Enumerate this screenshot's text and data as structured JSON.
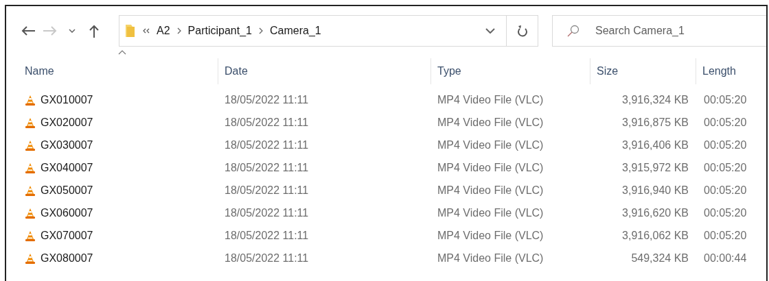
{
  "navigation": {
    "back_enabled": true,
    "forward_enabled": false
  },
  "address": {
    "segments": [
      {
        "label": "A2"
      },
      {
        "label": "Participant_1"
      },
      {
        "label": "Camera_1"
      }
    ]
  },
  "search": {
    "placeholder": "Search Camera_1"
  },
  "columns": [
    {
      "label": "Name",
      "sorted": true
    },
    {
      "label": "Date",
      "sorted": false
    },
    {
      "label": "Type",
      "sorted": false
    },
    {
      "label": "Size",
      "sorted": false
    },
    {
      "label": "Length",
      "sorted": false
    }
  ],
  "files": [
    {
      "name": "GX010007",
      "date": "18/05/2022 11:11",
      "type": "MP4 Video File (VLC)",
      "size": "3,916,324 KB",
      "length": "00:05:20"
    },
    {
      "name": "GX020007",
      "date": "18/05/2022 11:11",
      "type": "MP4 Video File (VLC)",
      "size": "3,916,875 KB",
      "length": "00:05:20"
    },
    {
      "name": "GX030007",
      "date": "18/05/2022 11:11",
      "type": "MP4 Video File (VLC)",
      "size": "3,916,406 KB",
      "length": "00:05:20"
    },
    {
      "name": "GX040007",
      "date": "18/05/2022 11:11",
      "type": "MP4 Video File (VLC)",
      "size": "3,915,972 KB",
      "length": "00:05:20"
    },
    {
      "name": "GX050007",
      "date": "18/05/2022 11:11",
      "type": "MP4 Video File (VLC)",
      "size": "3,916,940 KB",
      "length": "00:05:20"
    },
    {
      "name": "GX060007",
      "date": "18/05/2022 11:11",
      "type": "MP4 Video File (VLC)",
      "size": "3,916,620 KB",
      "length": "00:05:20"
    },
    {
      "name": "GX070007",
      "date": "18/05/2022 11:11",
      "type": "MP4 Video File (VLC)",
      "size": "3,916,062 KB",
      "length": "00:05:20"
    },
    {
      "name": "GX080007",
      "date": "18/05/2022 11:11",
      "type": "MP4 Video File (VLC)",
      "size": "549,324 KB",
      "length": "00:00:44"
    }
  ]
}
